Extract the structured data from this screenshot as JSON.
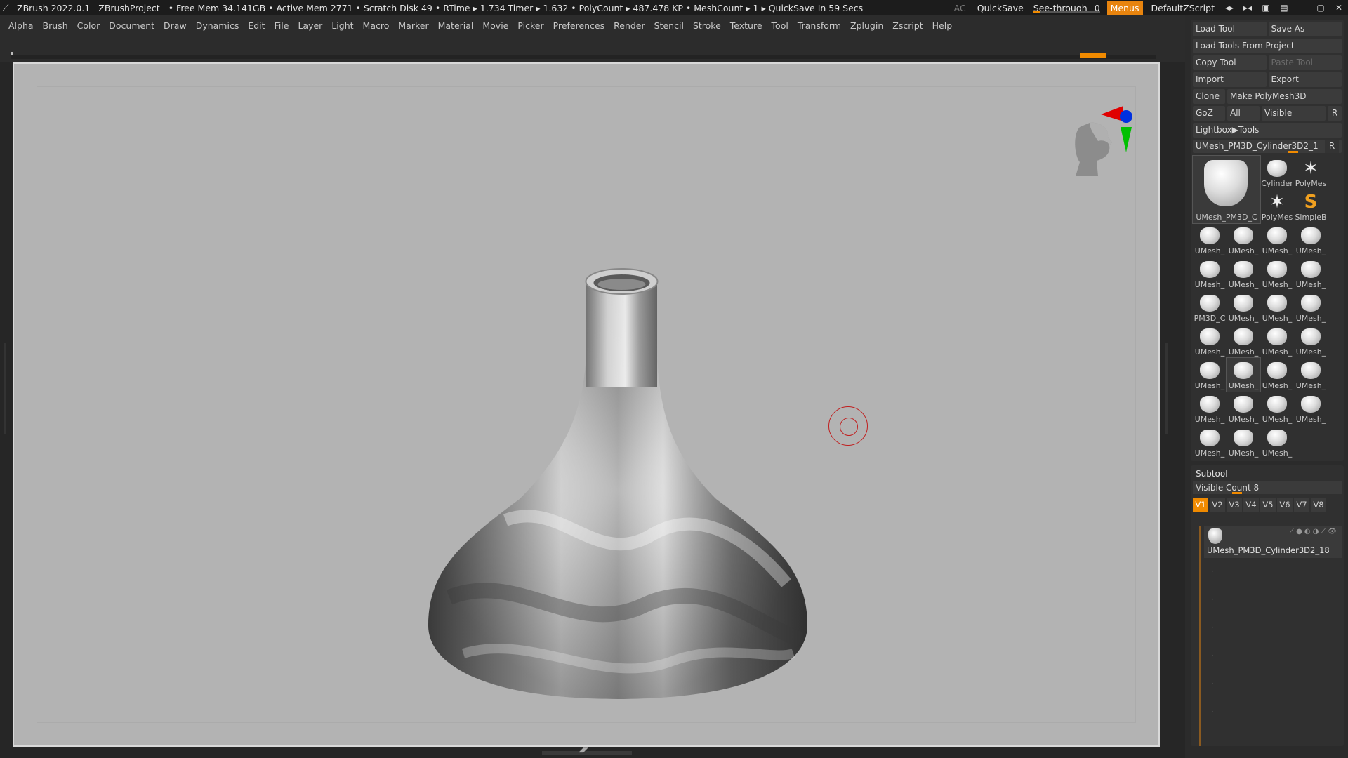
{
  "titlebar": {
    "app_name": "ZBrush 2022.0.1",
    "project": "ZBrushProject",
    "stats": "• Free Mem 34.141GB • Active Mem 2771 • Scratch Disk 49 •  RTime ▸ 1.734 Timer ▸ 1.632 • PolyCount ▸ 487.478 KP  • MeshCount ▸ 1   ▸ QuickSave In 59 Secs",
    "ac": "AC",
    "quicksave": "QuickSave",
    "see_through_label": "See-through",
    "see_through_value": "0",
    "menus": "Menus",
    "script": "DefaultZScript"
  },
  "menubar": {
    "items": [
      "Alpha",
      "Brush",
      "Color",
      "Document",
      "Draw",
      "Dynamics",
      "Edit",
      "File",
      "Layer",
      "Light",
      "Macro",
      "Marker",
      "Material",
      "Movie",
      "Picker",
      "Preferences",
      "Render",
      "Stencil",
      "Stroke",
      "Texture",
      "Tool",
      "Transform",
      "Zplugin",
      "Zscript",
      "Help"
    ]
  },
  "tool_panel": {
    "load_tool": "Load Tool",
    "save_as": "Save As",
    "load_tools_from_project": "Load Tools From Project",
    "copy_tool": "Copy Tool",
    "paste_tool": "Paste Tool",
    "import": "Import",
    "export": "Export",
    "clone": "Clone",
    "make_polymesh": "Make PolyMesh3D",
    "goz": "GoZ",
    "all": "All",
    "visible": "Visible",
    "r": "R",
    "lightbox_tools": "Lightbox▶Tools",
    "current_tool": "UMesh_PM3D_Cylinder3D2_1",
    "current_tool_r": "R",
    "tiles": [
      {
        "label": "UMesh_PM3D_C",
        "kind": "big"
      },
      {
        "label": "Cylinder",
        "kind": "normal"
      },
      {
        "label": "PolyMes",
        "kind": "star"
      },
      {
        "label": "PolyMes",
        "kind": "star"
      },
      {
        "label": "SimpleB",
        "kind": "snake"
      },
      {
        "label": "UMesh_",
        "kind": "normal"
      },
      {
        "label": "UMesh_",
        "kind": "normal"
      },
      {
        "label": "UMesh_",
        "kind": "normal"
      },
      {
        "label": "UMesh_",
        "kind": "normal"
      },
      {
        "label": "UMesh_",
        "kind": "normal"
      },
      {
        "label": "UMesh_",
        "kind": "normal"
      },
      {
        "label": "UMesh_",
        "kind": "normal"
      },
      {
        "label": "UMesh_",
        "kind": "normal"
      },
      {
        "label": "PM3D_C",
        "kind": "normal"
      },
      {
        "label": "UMesh_",
        "kind": "normal"
      },
      {
        "label": "UMesh_",
        "kind": "normal"
      },
      {
        "label": "UMesh_",
        "kind": "normal"
      },
      {
        "label": "UMesh_",
        "kind": "normal"
      },
      {
        "label": "UMesh_",
        "kind": "normal"
      },
      {
        "label": "UMesh_",
        "kind": "normal"
      },
      {
        "label": "UMesh_",
        "kind": "normal"
      },
      {
        "label": "UMesh_",
        "kind": "normal"
      },
      {
        "label": "UMesh_",
        "kind": "selected"
      },
      {
        "label": "UMesh_",
        "kind": "normal"
      },
      {
        "label": "UMesh_",
        "kind": "normal"
      },
      {
        "label": "UMesh_",
        "kind": "normal"
      },
      {
        "label": "UMesh_",
        "kind": "normal"
      },
      {
        "label": "UMesh_",
        "kind": "normal"
      },
      {
        "label": "UMesh_",
        "kind": "normal"
      },
      {
        "label": "UMesh_",
        "kind": "normal"
      },
      {
        "label": "UMesh_",
        "kind": "normal"
      },
      {
        "label": "UMesh_",
        "kind": "normal"
      }
    ]
  },
  "subtool": {
    "title": "Subtool",
    "visible_count_label": "Visible Count",
    "visible_count": "8",
    "vtabs": [
      "V1",
      "V2",
      "V3",
      "V4",
      "V5",
      "V6",
      "V7",
      "V8"
    ],
    "active_vtab": "V1",
    "item_name": "UMesh_PM3D_Cylinder3D2_18"
  },
  "colors": {
    "accent": "#f08a00",
    "canvas": "#b3b3b3",
    "panel": "#2b2b2b"
  }
}
